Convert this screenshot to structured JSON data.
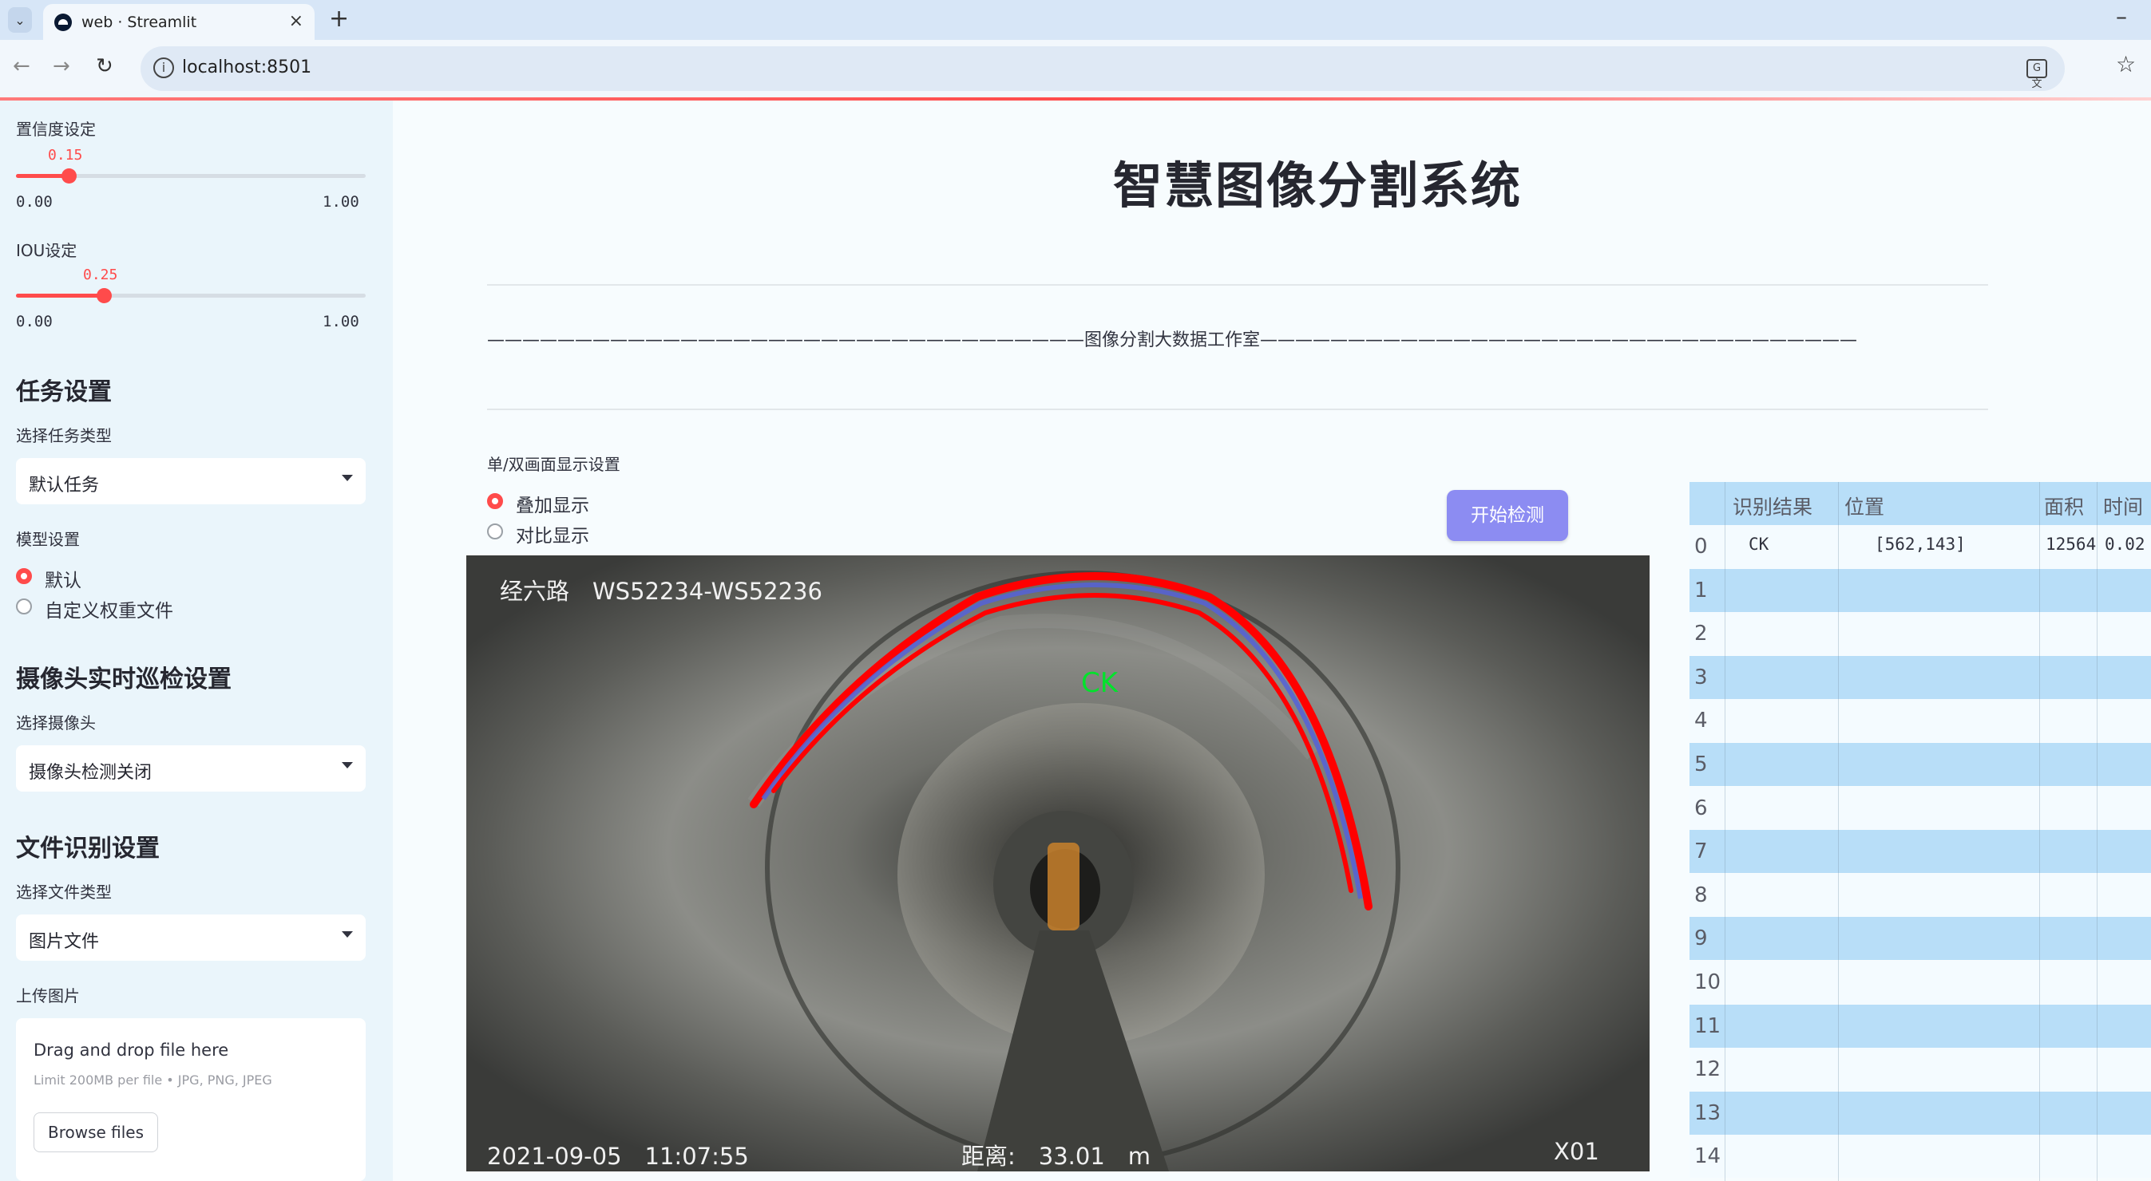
{
  "browser": {
    "tab_title": "web · Streamlit",
    "url": "localhost:8501"
  },
  "sidebar": {
    "confidence": {
      "label": "置信度设定",
      "value": "0.15",
      "min": "0.00",
      "max": "1.00",
      "fraction": 0.15
    },
    "iou": {
      "label": "IOU设定",
      "value": "0.25",
      "min": "0.00",
      "max": "1.00",
      "fraction": 0.25
    },
    "task_section": "任务设置",
    "task_type_label": "选择任务类型",
    "task_type_value": "默认任务",
    "model_label": "模型设置",
    "model_options": [
      "默认",
      "自定义权重文件"
    ],
    "model_selected": "默认",
    "camera_section": "摄像头实时巡检设置",
    "camera_label": "选择摄像头",
    "camera_value": "摄像头检测关闭",
    "file_section": "文件识别设置",
    "file_type_label": "选择文件类型",
    "file_type_value": "图片文件",
    "upload_label": "上传图片",
    "upload_title": "Drag and drop file here",
    "upload_limit": "Limit 200MB per file • JPG, PNG, JPEG",
    "browse_label": "Browse files"
  },
  "main": {
    "title": "智慧图像分割系统",
    "subtitle": "——————————————————————————————————图像分割大数据工作室——————————————————————————————————",
    "display_label": "单/双画面显示设置",
    "display_options": [
      "叠加显示",
      "对比显示"
    ],
    "display_selected": "叠加显示",
    "start_button": "开始检测"
  },
  "frame": {
    "road": "经六路　WS52234-WS52236",
    "timestamp": "2021-09-05　11:07:55",
    "distance": "距离:　33.01　m",
    "camera_id": "X01",
    "detection_label": "CK",
    "mask_color": "#ff0000"
  },
  "results": {
    "columns": [
      "识别结果",
      "位置",
      "面积",
      "时间"
    ],
    "rows": [
      {
        "index": "0",
        "result": "CK",
        "position": "[562,143]",
        "area": "12564",
        "time": "0.02"
      },
      {
        "index": "1",
        "result": "",
        "position": "",
        "area": "",
        "time": ""
      },
      {
        "index": "2",
        "result": "",
        "position": "",
        "area": "",
        "time": ""
      },
      {
        "index": "3",
        "result": "",
        "position": "",
        "area": "",
        "time": ""
      },
      {
        "index": "4",
        "result": "",
        "position": "",
        "area": "",
        "time": ""
      },
      {
        "index": "5",
        "result": "",
        "position": "",
        "area": "",
        "time": ""
      },
      {
        "index": "6",
        "result": "",
        "position": "",
        "area": "",
        "time": ""
      },
      {
        "index": "7",
        "result": "",
        "position": "",
        "area": "",
        "time": ""
      },
      {
        "index": "8",
        "result": "",
        "position": "",
        "area": "",
        "time": ""
      },
      {
        "index": "9",
        "result": "",
        "position": "",
        "area": "",
        "time": ""
      },
      {
        "index": "10",
        "result": "",
        "position": "",
        "area": "",
        "time": ""
      },
      {
        "index": "11",
        "result": "",
        "position": "",
        "area": "",
        "time": ""
      },
      {
        "index": "12",
        "result": "",
        "position": "",
        "area": "",
        "time": ""
      },
      {
        "index": "13",
        "result": "",
        "position": "",
        "area": "",
        "time": ""
      },
      {
        "index": "14",
        "result": "",
        "position": "",
        "area": "",
        "time": ""
      }
    ]
  },
  "colors": {
    "accent": "#ff4b4b",
    "button": "#8c8cf2",
    "table_stripe": "#b8def8"
  }
}
